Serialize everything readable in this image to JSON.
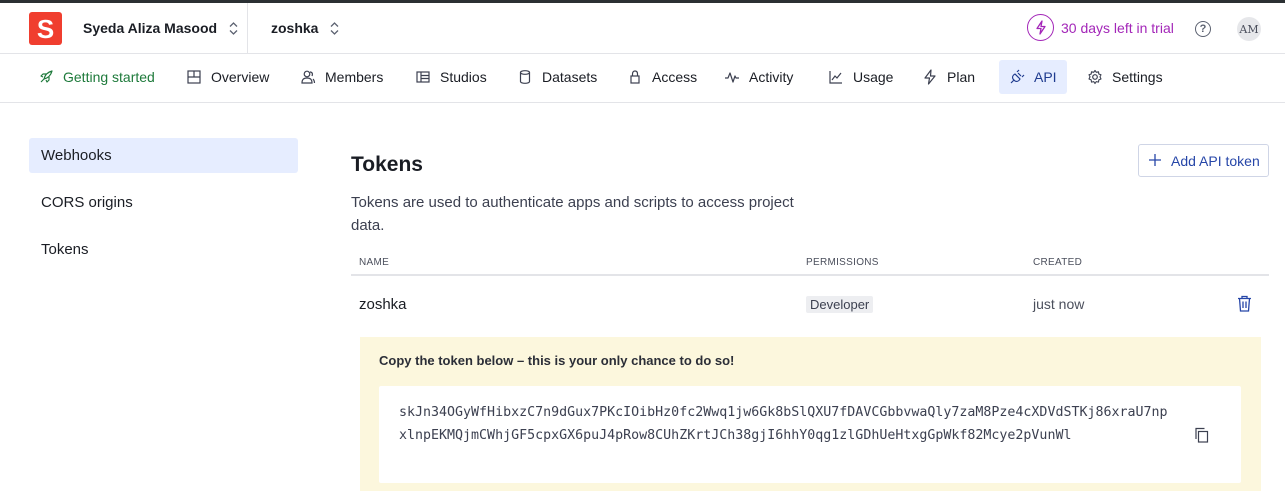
{
  "header": {
    "logo_letter": "S",
    "org_name": "Syeda Aliza Masood",
    "project_name": "zoshka",
    "trial_text": "30 days left in trial",
    "help_label": "?",
    "avatar_initials": "AM"
  },
  "nav": {
    "tabs": [
      {
        "label": "Getting started",
        "icon": "rocket-icon"
      },
      {
        "label": "Overview",
        "icon": "layout-icon"
      },
      {
        "label": "Members",
        "icon": "users-icon"
      },
      {
        "label": "Studios",
        "icon": "studio-icon"
      },
      {
        "label": "Datasets",
        "icon": "database-icon"
      },
      {
        "label": "Access",
        "icon": "lock-icon"
      },
      {
        "label": "Activity",
        "icon": "activity-icon"
      },
      {
        "label": "Usage",
        "icon": "chart-line-icon"
      },
      {
        "label": "Plan",
        "icon": "bolt-icon"
      },
      {
        "label": "API",
        "icon": "plug-icon"
      },
      {
        "label": "Settings",
        "icon": "gear-icon"
      }
    ],
    "active_tab": "API"
  },
  "sidebar": {
    "items": [
      {
        "label": "Webhooks"
      },
      {
        "label": "CORS origins"
      },
      {
        "label": "Tokens"
      }
    ],
    "active_item": "Webhooks"
  },
  "main": {
    "title": "Tokens",
    "description": "Tokens are used to authenticate apps and scripts to access project data.",
    "add_button_label": "Add API token",
    "table": {
      "headers": [
        "NAME",
        "PERMISSIONS",
        "CREATED"
      ],
      "rows": [
        {
          "name": "zoshka",
          "permissions": "Developer",
          "created": "just now"
        }
      ]
    },
    "notice": {
      "text": "Copy the token below – this is your only chance to do so!",
      "token": "skJn34OGyWfHibxzC7n9dGux7PKcIOibHz0fc2Wwq1jw6Gk8bSlQXU7fDAVCGbbvwaQly7zaM8Pze4cXDVdSTKj86xraU7npxlnpEKMQjmCWhjGF5cpxGX6puJ4pRow8CUhZKrtJCh38gjI6hhY0qg1zlGDhUeHtxgGpWkf82Mcye2pVunWl"
    }
  },
  "colors": {
    "brand": "#f03e2f",
    "trial": "#a326b8",
    "active_bg": "#e6edff",
    "notice_bg": "#fcf7dd",
    "accent_blue": "#2646a8"
  }
}
